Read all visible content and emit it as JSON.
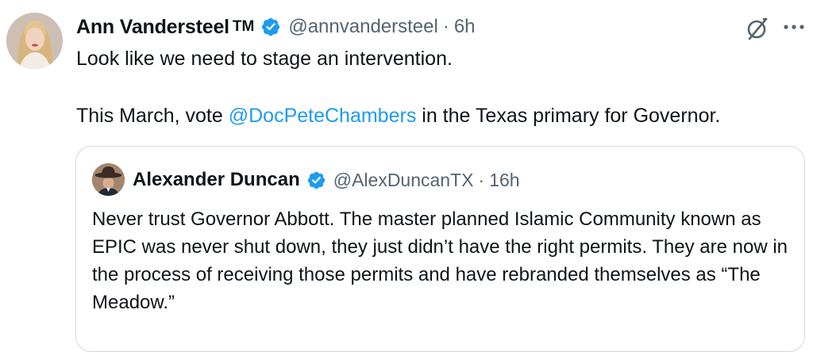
{
  "tweet": {
    "author": {
      "display_name": "Ann Vandersteel",
      "name_suffix": "TM",
      "handle": "@annvandersteel",
      "verified": true,
      "avatar": "avatar-photo"
    },
    "separator": "·",
    "time": "6h",
    "icons": {
      "grok": "grok-slash-circle-icon",
      "more": "more-dots-icon"
    },
    "text": {
      "line1": "Look like we need to stage an intervention.",
      "line2_prefix": "This March, vote ",
      "line2_mention": "@DocPeteChambers",
      "line2_suffix": " in the Texas primary for Governor."
    },
    "colors": {
      "mention": "#1d9bf0",
      "verified_badge": "#1d9bf0",
      "secondary_text": "#536471",
      "border": "#cfd9de"
    }
  },
  "quote": {
    "author": {
      "display_name": "Alexander Duncan",
      "handle": "@AlexDuncanTX",
      "verified": true,
      "avatar": "avatar-photo-cowboy-hat"
    },
    "separator": "·",
    "time": "16h",
    "text": "Never trust Governor Abbott. The master planned Islamic Community known as EPIC was never shut down, they just didn’t have the right permits. They are now in the process of receiving those permits and have rebranded themselves as “The Meadow.”"
  }
}
